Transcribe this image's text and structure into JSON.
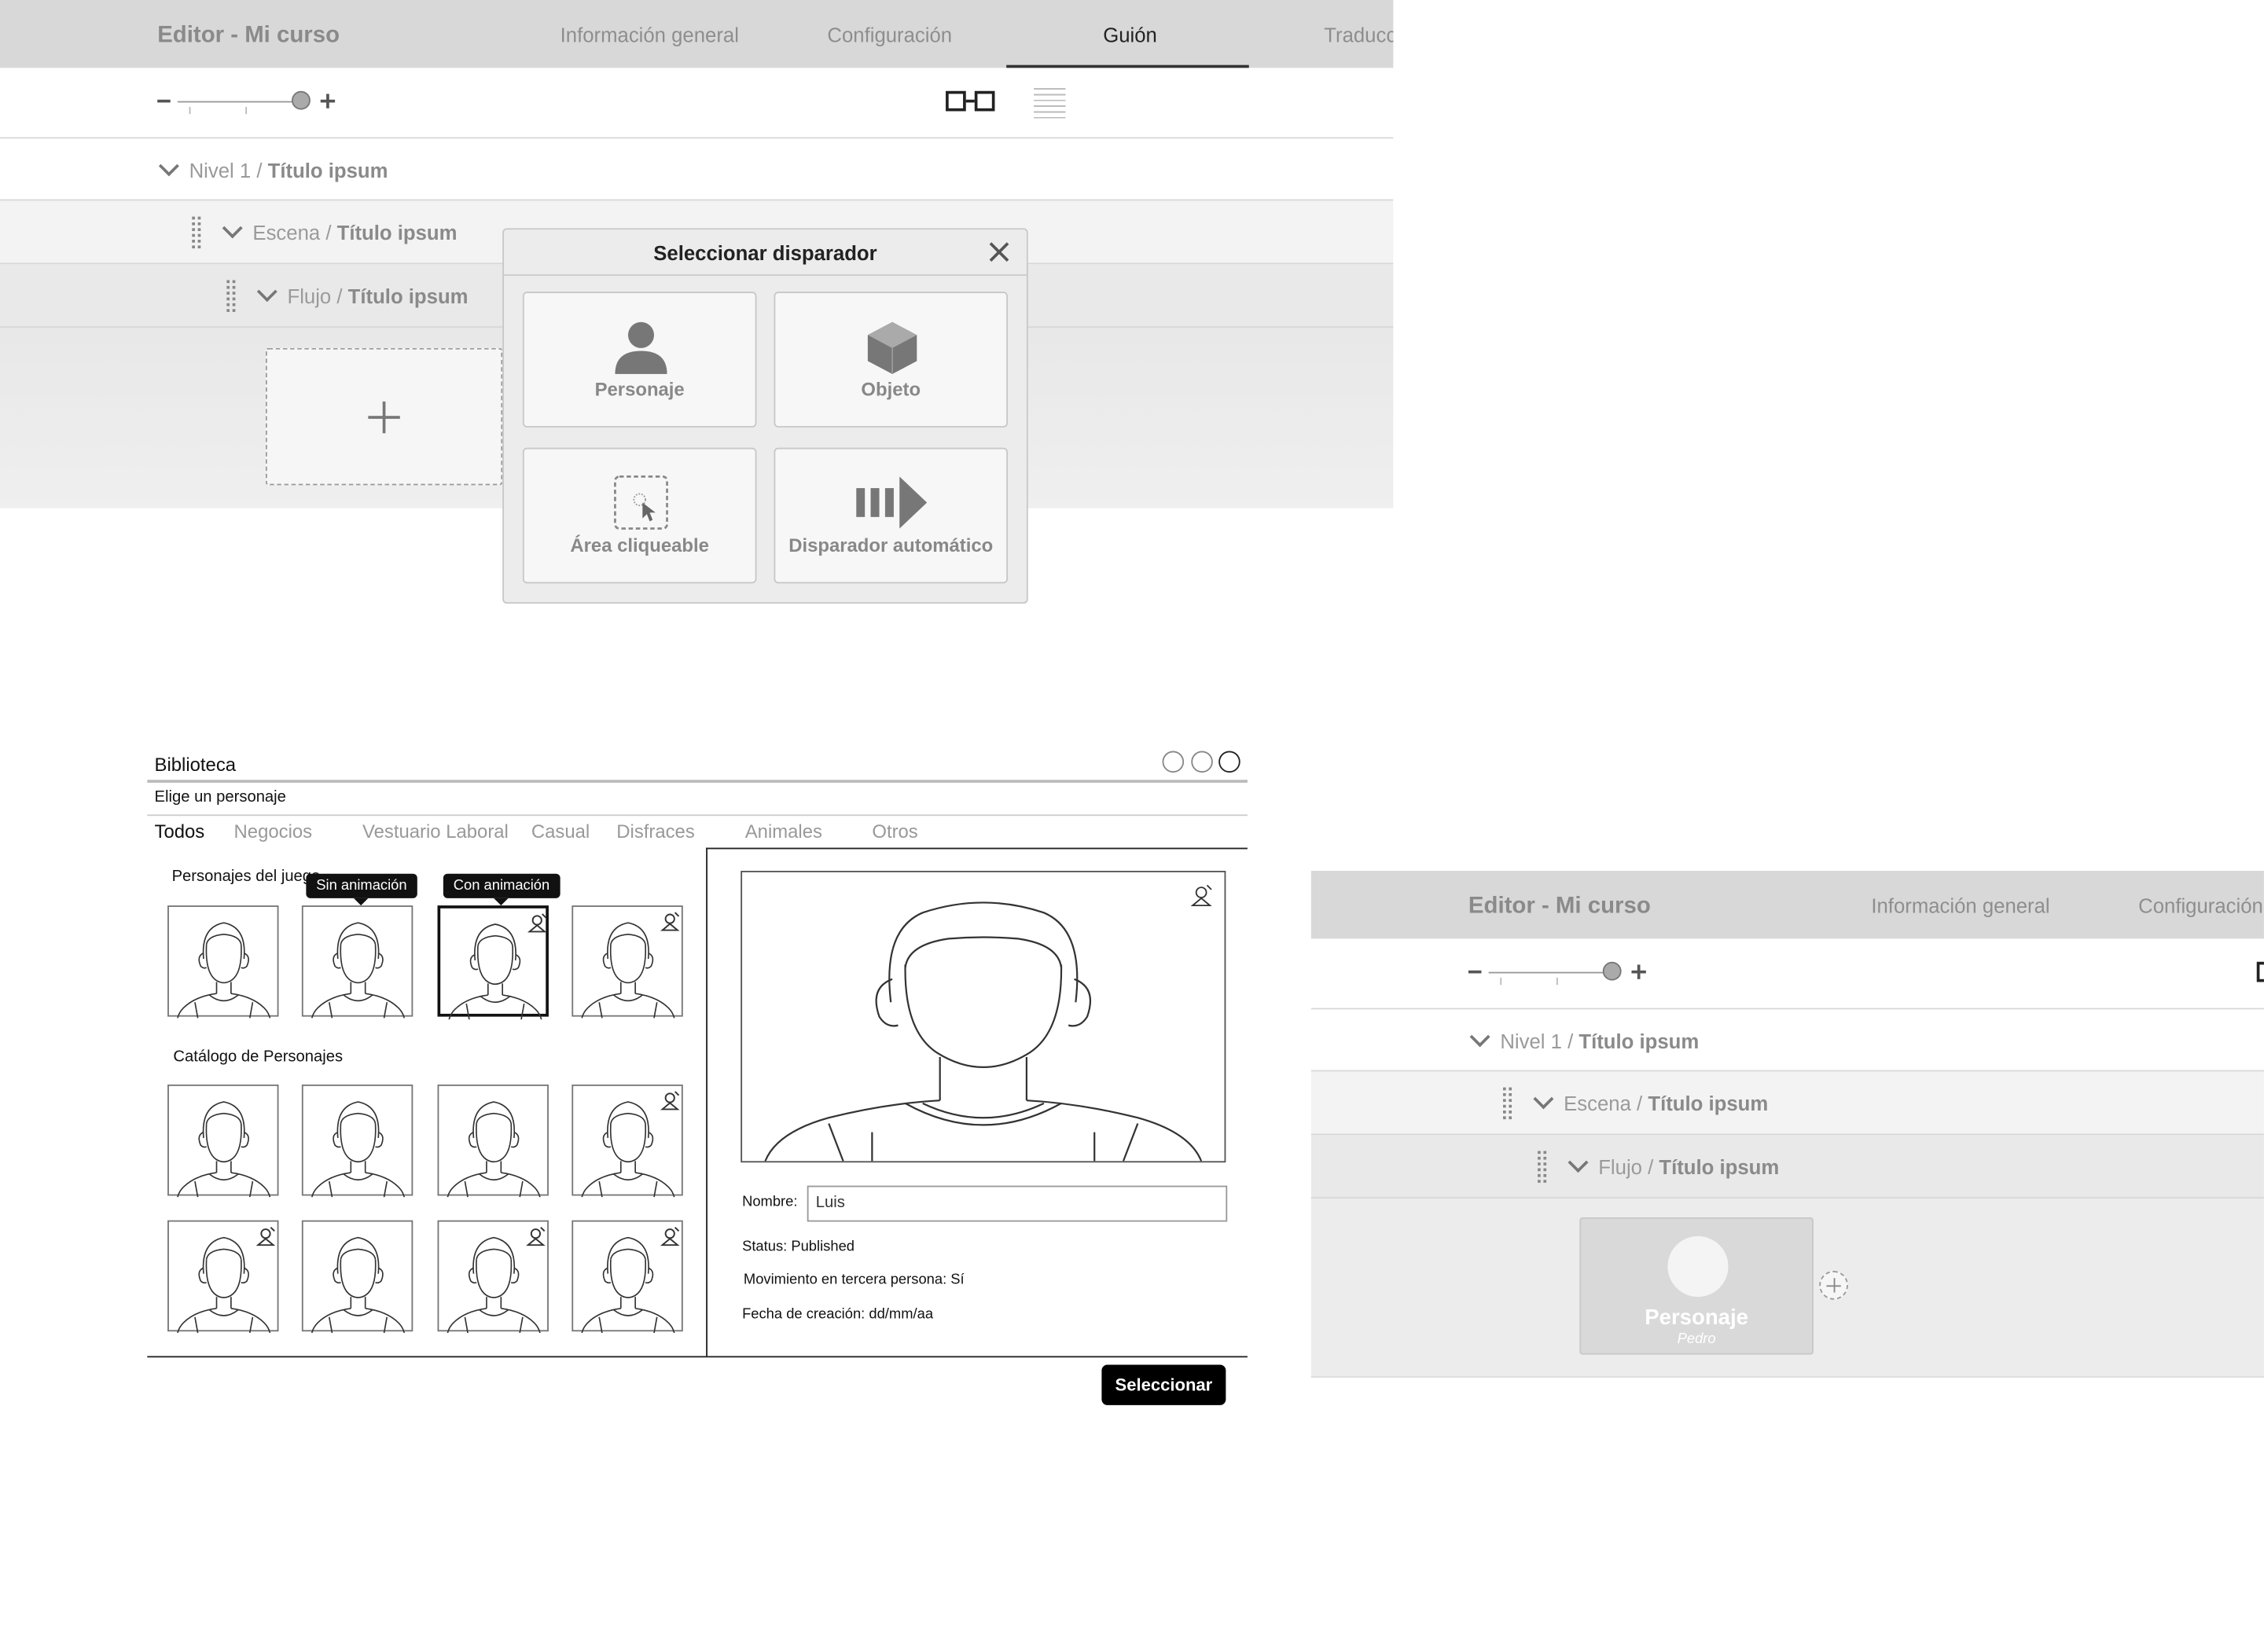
{
  "editor": {
    "app_title": "Editor - Mi curso",
    "tabs": [
      "Información general",
      "Configuración",
      "Guión",
      "Traducción"
    ],
    "active_tab": "Guión",
    "tree": {
      "nivel_prefix": "Nivel 1 / ",
      "nivel_title": "Título ipsum",
      "escena_prefix": "Escena / ",
      "escena_title": "Título ipsum",
      "flujo_prefix": "Flujo / ",
      "flujo_title": "Título ipsum"
    }
  },
  "trigger_modal": {
    "title": "Seleccionar disparador",
    "options": [
      "Personaje",
      "Objeto",
      "Área cliqueable",
      "Disparador automático"
    ]
  },
  "library": {
    "title": "Biblioteca",
    "subtitle": "Elige un personaje",
    "tabs": [
      "Todos",
      "Negocios",
      "Vestuario Laboral",
      "Casual",
      "Disfraces",
      "Animales",
      "Otros"
    ],
    "active_tab": "Todos",
    "section_game": "Personajes del juego",
    "section_catalog": "Catálogo de Personajes",
    "tooltip_no_anim": "Sin animación",
    "tooltip_anim": "Con animación",
    "detail": {
      "name_label": "Nombre:",
      "name_value": "Luis",
      "status": "Status: Published",
      "movement": "Movimiento en tercera persona: Sí",
      "created": "Fecha de creación: dd/mm/aa"
    },
    "select_button": "Seleccionar"
  },
  "result_card": {
    "label": "Personaje",
    "name": "Pedro"
  },
  "colors": {
    "header_bg": "#d8d8d8",
    "row_bg": "#efefef",
    "accent": "#000000"
  }
}
